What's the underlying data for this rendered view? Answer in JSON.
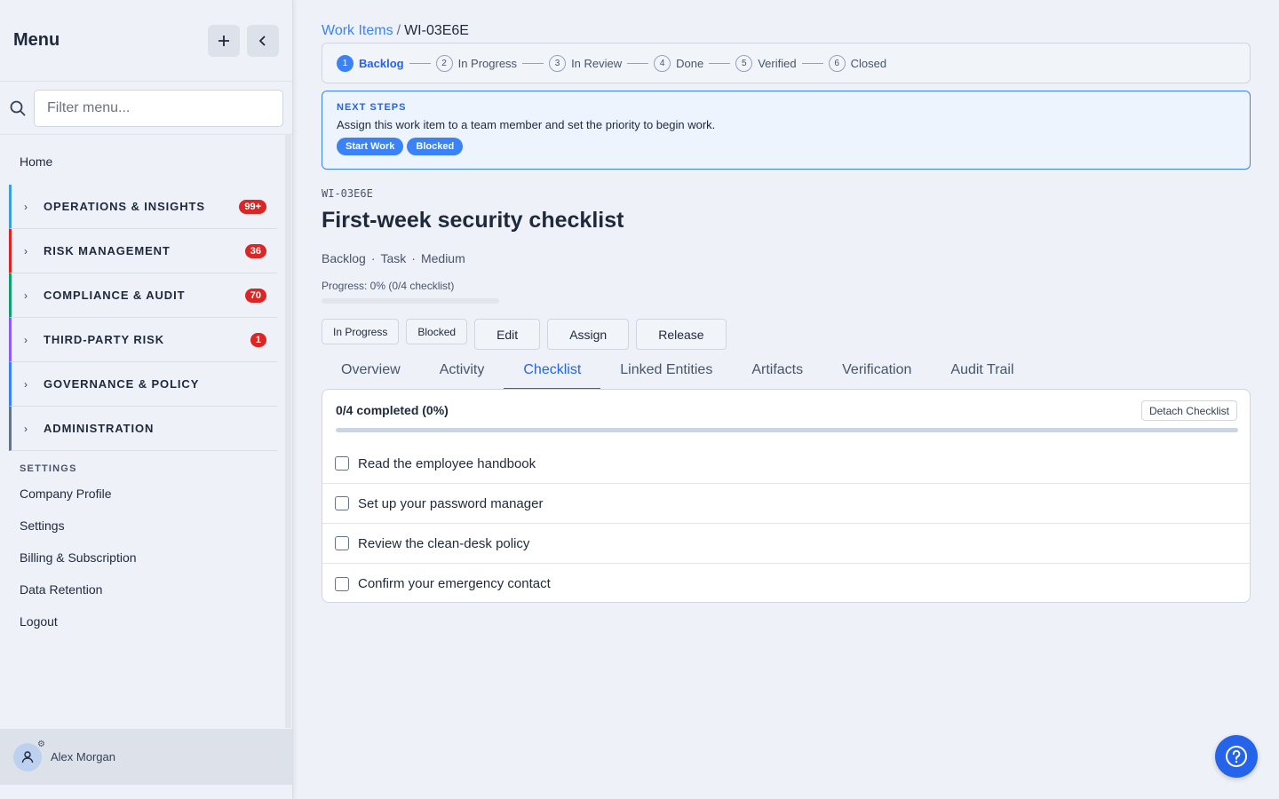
{
  "sidebar": {
    "title": "Menu",
    "filter_placeholder": "Filter menu...",
    "home": "Home",
    "sections": [
      {
        "label": "OPERATIONS & INSIGHTS",
        "badge": "99+",
        "color": "#3b9fd8"
      },
      {
        "label": "RISK MANAGEMENT",
        "badge": "36",
        "color": "#dc2626"
      },
      {
        "label": "COMPLIANCE & AUDIT",
        "badge": "70",
        "color": "#0f9f6e"
      },
      {
        "label": "THIRD-PARTY RISK",
        "badge": "1",
        "color": "#8b5cf6"
      },
      {
        "label": "GOVERNANCE & POLICY",
        "badge": "",
        "color": "#3b82f6"
      },
      {
        "label": "ADMINISTRATION",
        "badge": "",
        "color": "#64748b"
      }
    ],
    "settings_header": "SETTINGS",
    "settings_items": [
      "Company Profile",
      "Settings",
      "Billing & Subscription",
      "Data Retention",
      "Logout"
    ],
    "user": "Alex Morgan"
  },
  "breadcrumb": {
    "parent": "Work Items",
    "separator": "/",
    "current": "WI-03E6E"
  },
  "stepper": [
    {
      "num": "1",
      "label": "Backlog"
    },
    {
      "num": "2",
      "label": "In Progress"
    },
    {
      "num": "3",
      "label": "In Review"
    },
    {
      "num": "4",
      "label": "Done"
    },
    {
      "num": "5",
      "label": "Verified"
    },
    {
      "num": "6",
      "label": "Closed"
    }
  ],
  "next_steps": {
    "header": "NEXT STEPS",
    "text": "Assign this work item to a team member and set the priority to begin work.",
    "buttons": [
      "Start Work",
      "Blocked"
    ]
  },
  "item": {
    "id": "WI-03E6E",
    "title": "First-week security checklist",
    "status": "Backlog",
    "type": "Task",
    "priority": "Medium",
    "progress_label": "Progress: 0% (0/4 checklist)",
    "progress": 0
  },
  "actions": {
    "small": [
      "In Progress",
      "Blocked"
    ],
    "large": [
      "Edit",
      "Assign",
      "Release"
    ]
  },
  "tabs": [
    "Overview",
    "Activity",
    "Checklist",
    "Linked Entities",
    "Artifacts",
    "Verification",
    "Audit Trail"
  ],
  "active_tab": "Checklist",
  "checklist": {
    "summary": "0/4 completed (0%)",
    "detach_label": "Detach Checklist",
    "items": [
      {
        "text": "Read the employee handbook",
        "checked": false
      },
      {
        "text": "Set up your password manager",
        "checked": false
      },
      {
        "text": "Review the clean-desk policy",
        "checked": false
      },
      {
        "text": "Confirm your emergency contact",
        "checked": false
      }
    ]
  },
  "icons": {
    "add": "plus-icon",
    "collapse": "chevron-left-icon",
    "search": "search-icon",
    "user": "user-icon",
    "help": "help-circle-icon"
  },
  "colors": {
    "accent": "#3b82f6",
    "badge": "#dc2626"
  }
}
